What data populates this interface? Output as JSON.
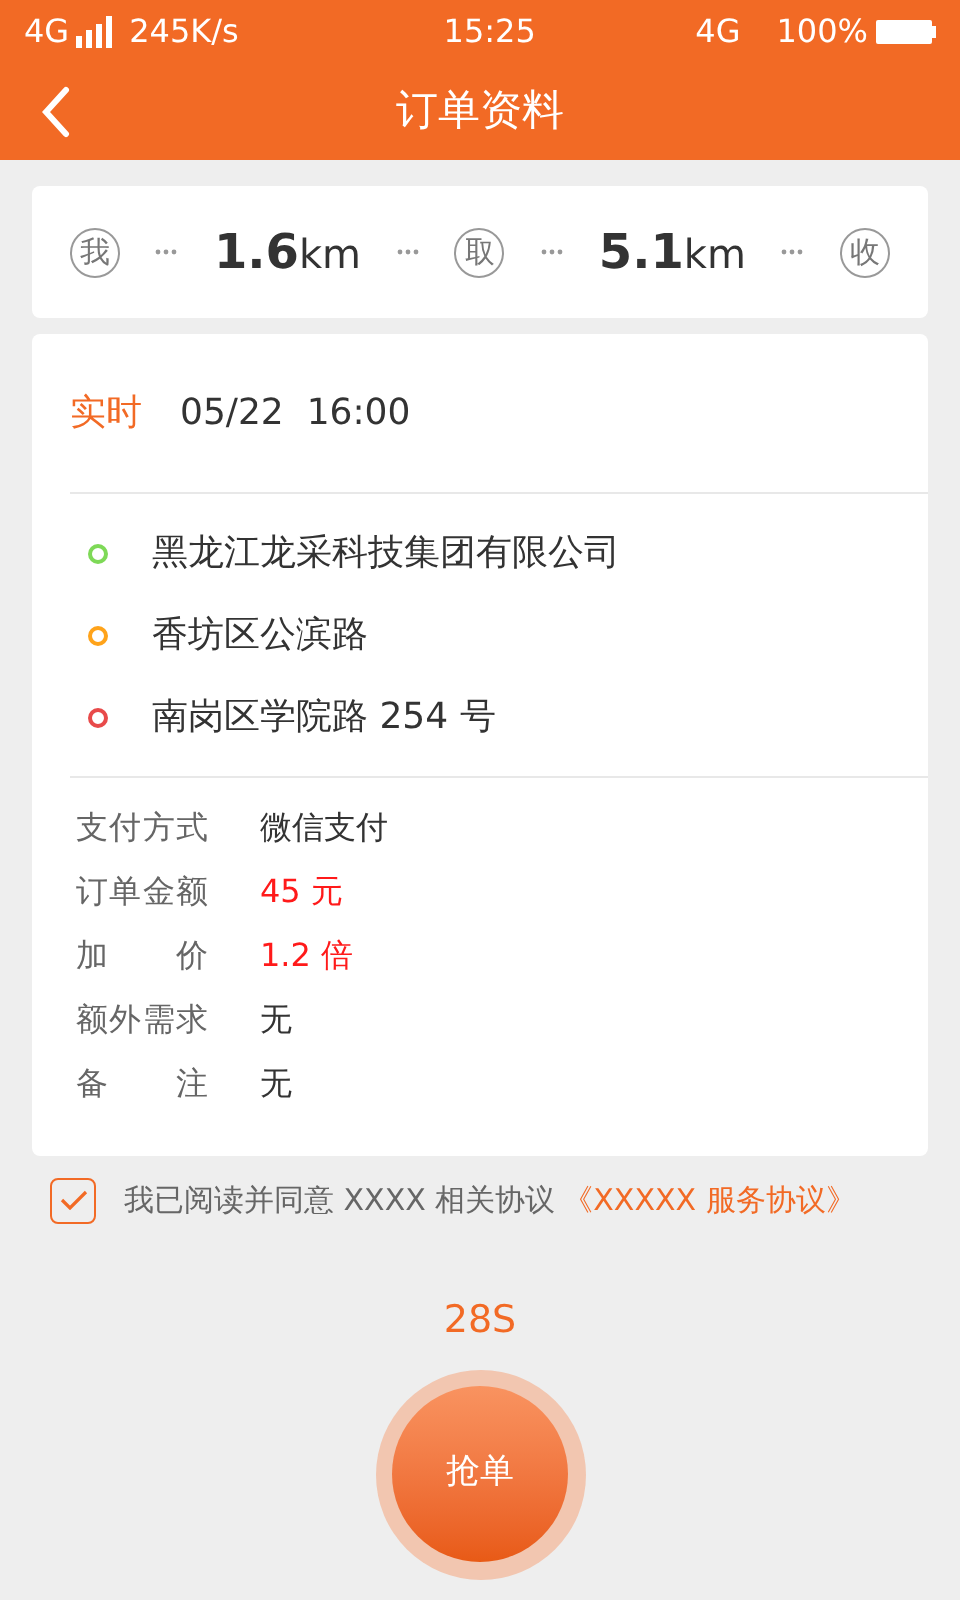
{
  "status_bar": {
    "network_left": "4G",
    "speed": "245K/s",
    "time": "15:25",
    "network_right": "4G",
    "battery": "100%"
  },
  "header": {
    "title": "订单资料"
  },
  "route": {
    "points": [
      "我",
      "取",
      "收"
    ],
    "segments": [
      {
        "value": "1.6",
        "unit": "km"
      },
      {
        "value": "5.1",
        "unit": "km"
      }
    ]
  },
  "order": {
    "type": "实时",
    "datetime": "05/22  16:00",
    "addresses": [
      {
        "text": "黑龙江龙采科技集团有限公司",
        "color": "#7ed957"
      },
      {
        "text": "香坊区公滨路",
        "color": "#ffa31a"
      },
      {
        "text": "南岗区学院路 254 号",
        "color": "#e84a4a"
      }
    ],
    "details": [
      {
        "label": "支付方式",
        "value": "微信支付",
        "highlight": false
      },
      {
        "label": "订单金额",
        "value": "45 元",
        "highlight": true
      },
      {
        "label": "加价",
        "value": "1.2 倍",
        "highlight": true
      },
      {
        "label": "额外需求",
        "value": "无",
        "highlight": false
      },
      {
        "label": "备注",
        "value": "无",
        "highlight": false
      }
    ]
  },
  "agreement": {
    "checked": true,
    "text": "我已阅读并同意 XXXX 相关协议",
    "link": "《XXXXX 服务协议》"
  },
  "countdown": "28S",
  "grab_button": "抢单"
}
